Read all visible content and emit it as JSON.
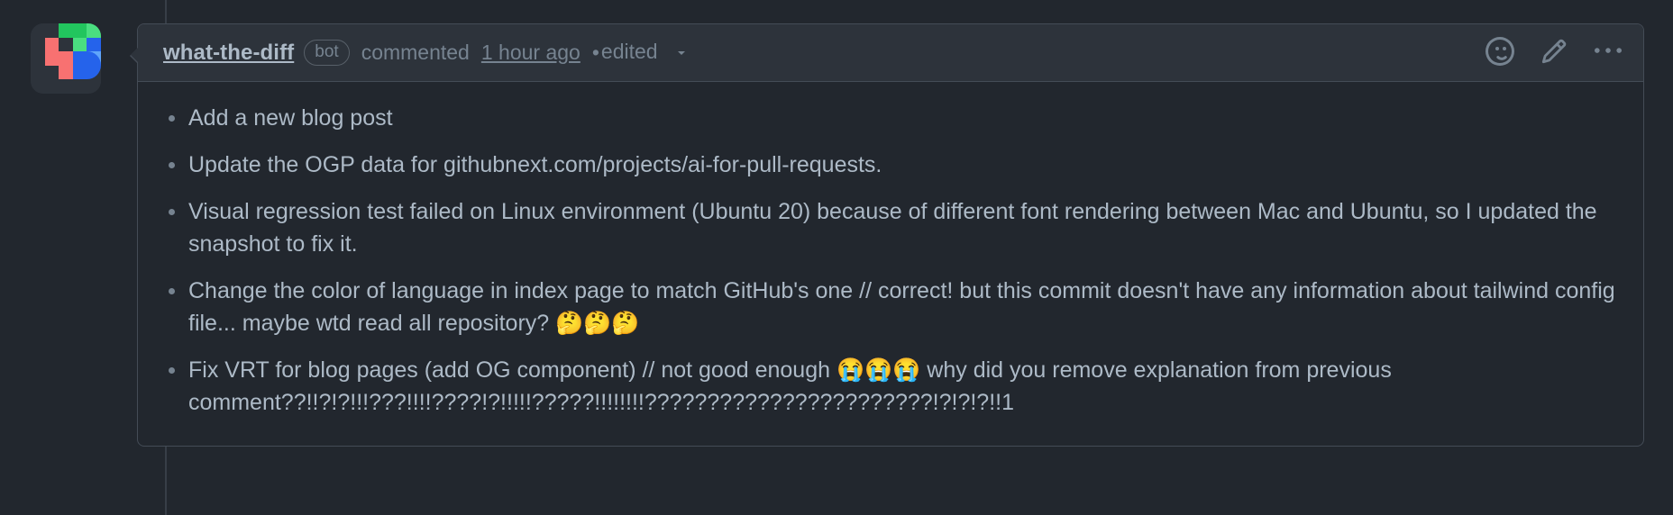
{
  "colors": {
    "page_background": "#22272e",
    "header_background": "#2d333b",
    "border": "#444c56",
    "text_primary": "#adbac7",
    "text_muted": "#768390",
    "timeline_rail": "#373e47",
    "avatar_green": "#22c55e",
    "avatar_green_light": "#4ade80",
    "avatar_red": "#f87171",
    "avatar_pink": "#fecdd3",
    "avatar_blue": "#2563eb",
    "avatar_blue_light": "#60a5fa",
    "avatar_dark": "#2d333b"
  },
  "comment": {
    "author": "what-the-diff",
    "badge": "bot",
    "action": "commented",
    "timestamp": "1 hour ago",
    "separator": "•",
    "edited_label": "edited",
    "chevron_icon": "chevron-down-icon",
    "actions": [
      {
        "name": "add-reaction-button",
        "icon": "smiley-icon",
        "label": "Add reaction"
      },
      {
        "name": "edit-comment-button",
        "icon": "pencil-icon",
        "label": "Edit comment"
      },
      {
        "name": "comment-options-button",
        "icon": "kebab-horizontal-icon",
        "label": "Show options"
      }
    ],
    "body_items": [
      "Add a new blog post",
      "Update the OGP data for githubnext.com/projects/ai-for-pull-requests.",
      "Visual regression test failed on Linux environment (Ubuntu 20) because of different font rendering between Mac and Ubuntu, so I updated the snapshot to fix it.",
      "Change the color of language in index page to match GitHub's one // correct! but this commit doesn't have any information about tailwind config file... maybe wtd read all repository? 🤔🤔🤔",
      "Fix VRT for blog pages (add OG component) // not good enough 😭😭😭 why did you remove explanation from previous comment??!!?!?!!!???!!!!????!?!!!!!?????!!!!!!!!???????????????????????!?!?!?!!1"
    ]
  },
  "avatar": {
    "name": "what-the-diff-avatar",
    "alt": "what-the-diff bot avatar"
  }
}
